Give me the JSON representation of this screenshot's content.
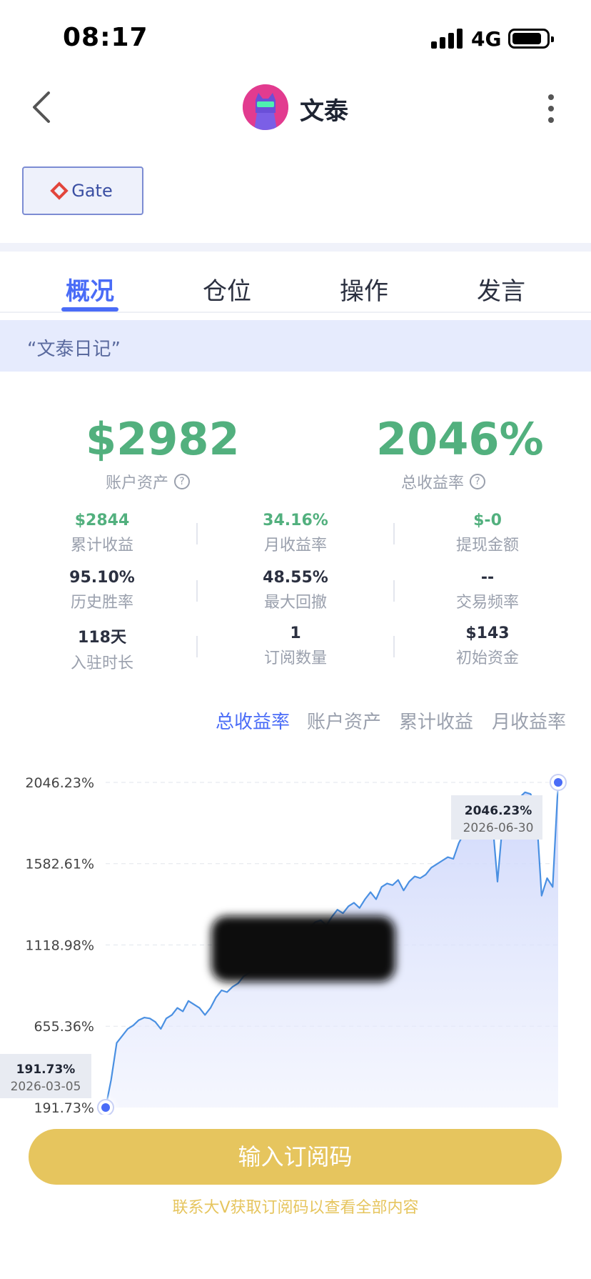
{
  "status_bar": {
    "time": "08:17",
    "network": "4G"
  },
  "nav": {
    "title": "文泰",
    "back_icon": "chevron-left-icon",
    "more_icon": "more-vertical-icon"
  },
  "exchange": {
    "label": "Gate",
    "icon": "gate-logo-icon",
    "accent": "#e2453c"
  },
  "tabs": [
    {
      "label": "概况",
      "active": true
    },
    {
      "label": "仓位",
      "active": false
    },
    {
      "label": "操作",
      "active": false
    },
    {
      "label": "发言",
      "active": false
    }
  ],
  "diary_title": "“文泰日记”",
  "headline": {
    "assets_value": "$2982",
    "assets_label": "账户资产",
    "return_value": "2046%",
    "return_label": "总收益率",
    "help_icon": "question-circle-icon"
  },
  "stats": [
    {
      "value": "$2844",
      "label": "累计收益",
      "green": true
    },
    {
      "value": "34.16%",
      "label": "月收益率",
      "green": true
    },
    {
      "value": "$-0",
      "label": "提现金额",
      "green": true
    },
    {
      "value": "95.10%",
      "label": "历史胜率",
      "green": false
    },
    {
      "value": "48.55%",
      "label": "最大回撤",
      "green": false
    },
    {
      "value": "--",
      "label": "交易频率",
      "green": false
    },
    {
      "value": "118天",
      "label": "入驻时长",
      "green": false
    },
    {
      "value": "1",
      "label": "订阅数量",
      "green": false
    },
    {
      "value": "$143",
      "label": "初始资金",
      "green": false
    }
  ],
  "metric_tabs": [
    {
      "label": "总收益率",
      "active": true
    },
    {
      "label": "账户资产",
      "active": false
    },
    {
      "label": "累计收益",
      "active": false
    },
    {
      "label": "月收益率",
      "active": false
    }
  ],
  "chart_data": {
    "type": "area",
    "title": "",
    "xlabel": "",
    "ylabel": "",
    "y_ticks": [
      "2046.23%",
      "1582.61%",
      "1118.98%",
      "655.36%",
      "191.73%"
    ],
    "y_tick_values": [
      2046.23,
      1582.61,
      1118.98,
      655.36,
      191.73
    ],
    "ylim": [
      191.73,
      2046.23
    ],
    "x_start": "2026-03-05",
    "x_end": "2026-06-30",
    "start_marker": {
      "value": "191.73%",
      "date": "2026-03-05"
    },
    "end_marker": {
      "value": "2046.23%",
      "date": "2026-06-30"
    },
    "series": [
      {
        "color": "#4a90e2",
        "values": [
          191.73,
          350,
          560,
          600,
          640,
          660,
          690,
          705,
          700,
          680,
          640,
          700,
          720,
          760,
          740,
          800,
          780,
          760,
          720,
          760,
          820,
          860,
          850,
          880,
          900,
          940,
          960,
          990,
          1020,
          1050,
          1080,
          1110,
          1140,
          1180,
          1150,
          1200,
          1160,
          1220,
          1250,
          1260,
          1230,
          1280,
          1320,
          1300,
          1340,
          1360,
          1330,
          1380,
          1420,
          1380,
          1450,
          1470,
          1460,
          1490,
          1430,
          1480,
          1510,
          1500,
          1520,
          1560,
          1580,
          1600,
          1620,
          1610,
          1700,
          1760,
          1820,
          1880,
          1910,
          1900,
          1860,
          1480,
          1840,
          1920,
          1860,
          1960,
          1990,
          1980,
          1900,
          1400,
          1500,
          1450,
          2046.23
        ]
      }
    ]
  },
  "cta": {
    "label": "输入订阅码",
    "hint": "联系大V获取订阅码以查看全部内容"
  },
  "colors": {
    "accent": "#4a6cf7",
    "green": "#52b07e",
    "gold": "#e6c55e",
    "line": "#4a90e2"
  }
}
